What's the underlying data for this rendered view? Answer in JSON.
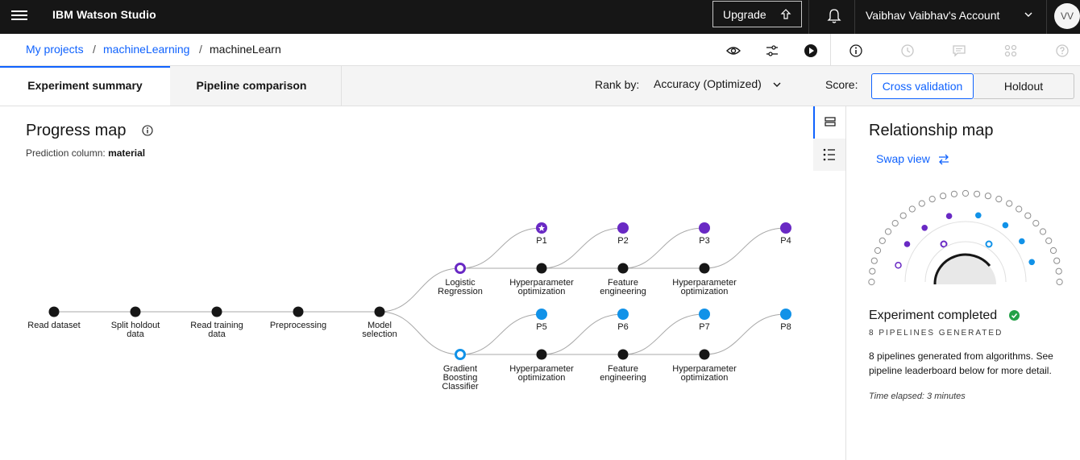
{
  "header": {
    "app_title": "IBM Watson Studio",
    "upgrade_label": "Upgrade",
    "account_label": "Vaibhav Vaibhav's Account",
    "avatar_initials": "VV"
  },
  "breadcrumb": {
    "items": [
      "My projects",
      "machineLearning",
      "machineLearn"
    ],
    "separator": "/"
  },
  "tabs": [
    {
      "label": "Experiment summary",
      "active": true
    },
    {
      "label": "Pipeline comparison",
      "active": false
    }
  ],
  "rank": {
    "label": "Rank by:",
    "value": "Accuracy (Optimized)"
  },
  "score": {
    "label": "Score:",
    "options": [
      "Cross validation",
      "Holdout"
    ],
    "selected": "Cross validation"
  },
  "progress": {
    "title": "Progress map",
    "prediction_label": "Prediction column:",
    "prediction_value": "material",
    "main_steps": [
      "Read dataset",
      "Split holdout data",
      "Read training data",
      "Preprocessing",
      "Model selection"
    ],
    "algorithms": [
      "Logistic Regression",
      "Gradient Boosting Classifier"
    ],
    "stage_labels": [
      "Hyperparameter optimization",
      "Feature engineering",
      "Hyperparameter optimization"
    ],
    "pipelines_top": [
      "P1",
      "P2",
      "P3",
      "P4"
    ],
    "pipelines_bottom": [
      "P5",
      "P6",
      "P7",
      "P8"
    ],
    "colors": {
      "logistic": "#6929c4",
      "gradient": "#1192e8",
      "node": "#161616",
      "edge": "#a8a8a8"
    }
  },
  "relationship": {
    "title": "Relationship map",
    "swap_label": "Swap view",
    "status_title": "Experiment completed",
    "pipelines_generated": "8 PIPELINES GENERATED",
    "description": "8 pipelines generated from algorithms. See pipeline leaderboard below for more detail.",
    "elapsed": "Time elapsed: 3 minutes"
  }
}
